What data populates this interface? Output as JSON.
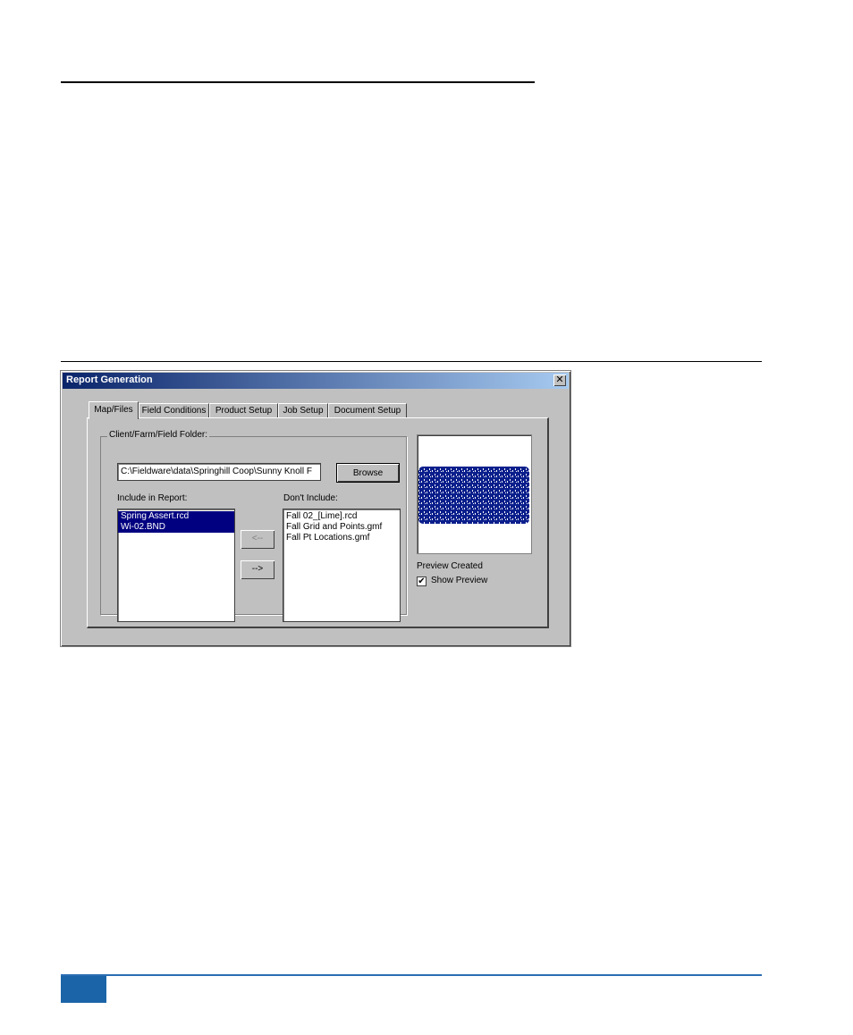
{
  "dialog": {
    "title": "Report Generation",
    "close_glyph": "✕"
  },
  "tabs": [
    {
      "label": "Map/Files",
      "active": true
    },
    {
      "label": "Field Conditions",
      "active": false
    },
    {
      "label": "Product Setup",
      "active": false
    },
    {
      "label": "Job Setup",
      "active": false
    },
    {
      "label": "Document Setup",
      "active": false
    }
  ],
  "folder": {
    "group_label": "Client/Farm/Field Folder:",
    "path_value": "C:\\Fieldware\\data\\Springhill Coop\\Sunny Knoll F",
    "browse_label": "Browse"
  },
  "include": {
    "label": "Include in Report:",
    "items": [
      "Spring Assert.rcd",
      "Wi-02.BND"
    ]
  },
  "exclude": {
    "label": "Don't Include:",
    "items": [
      "Fall 02_[Lime].rcd",
      "Fall Grid and Points.gmf",
      "Fall Pt Locations.gmf"
    ]
  },
  "move_buttons": {
    "left_label": "<--",
    "right_label": "-->"
  },
  "preview": {
    "status": "Preview Created",
    "show_preview_label": "Show Preview",
    "show_preview_checked": true,
    "check_glyph": "✔",
    "map_color": "#0b1f8c"
  }
}
